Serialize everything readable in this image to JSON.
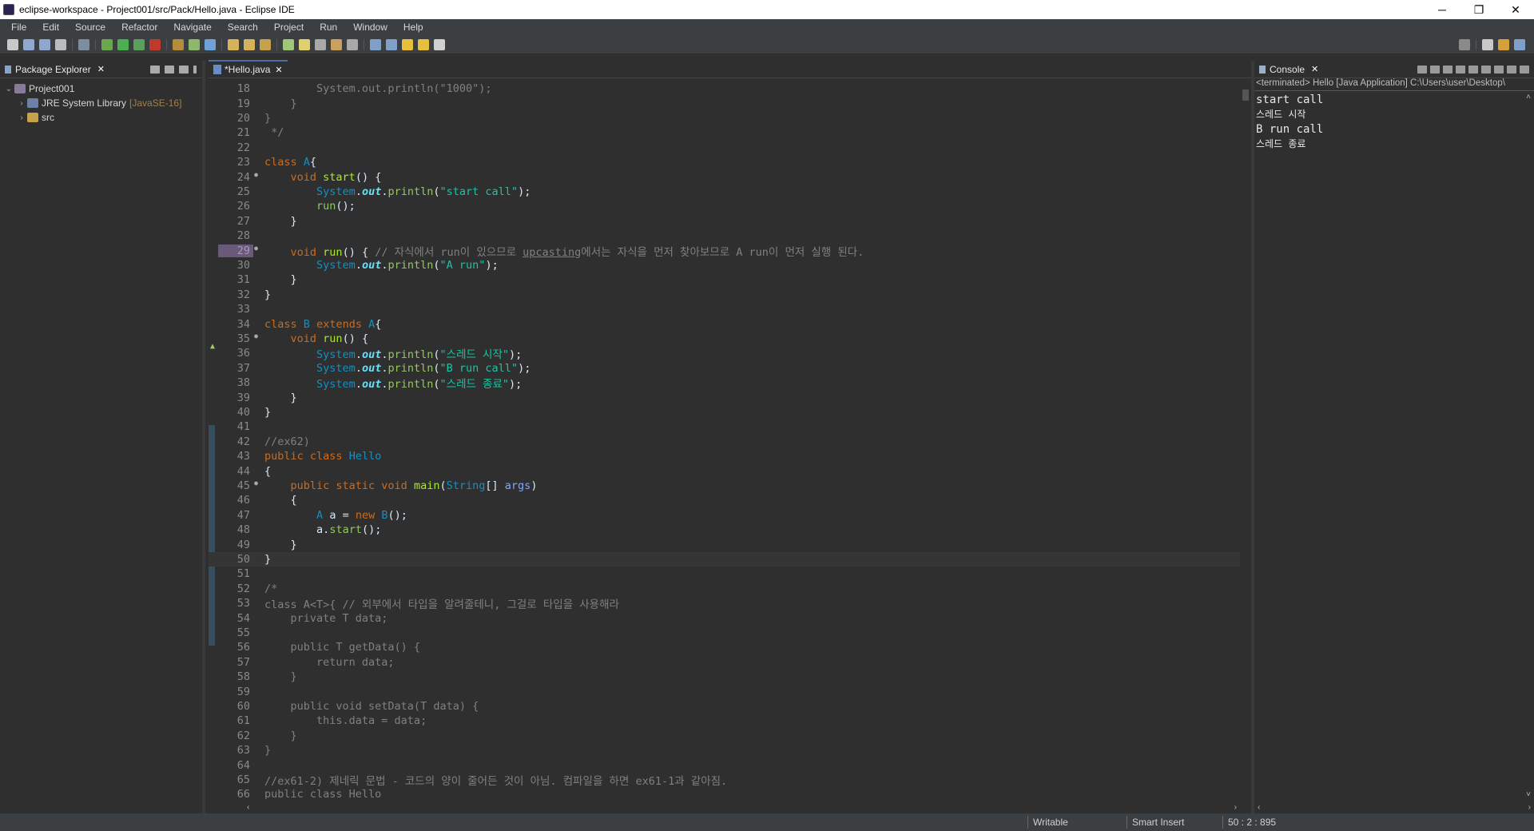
{
  "window": {
    "title": "eclipse-workspace - Project001/src/Pack/Hello.java - Eclipse IDE",
    "minimize": "─",
    "restore": "❐",
    "close": "✕"
  },
  "menu": [
    "File",
    "Edit",
    "Source",
    "Refactor",
    "Navigate",
    "Search",
    "Project",
    "Run",
    "Window",
    "Help"
  ],
  "package_explorer": {
    "tab_label": "Package Explorer",
    "tree": [
      {
        "label": "Project001",
        "arrow": "⌄",
        "decor": ""
      },
      {
        "label": "JRE System Library",
        "arrow": "›",
        "decor": "[JavaSE-16]"
      },
      {
        "label": "src",
        "arrow": "›",
        "decor": ""
      }
    ]
  },
  "editor": {
    "tab_label": "*Hello.java",
    "current_line": 50,
    "marked_line": 29
  },
  "console": {
    "tab_label": "Console",
    "status": "<terminated> Hello [Java Application] C:\\Users\\user\\Desktop\\",
    "output": [
      "start call",
      "스레드 시작",
      "B run call",
      "스레드 종료"
    ]
  },
  "statusbar": {
    "writable": "Writable",
    "insert_mode": "Smart Insert",
    "position": "50 : 2 : 895"
  },
  "colors": {
    "keyword": "#cc6c1d",
    "type": "#1290c3",
    "string": "#17c6a3",
    "comment": "#808080",
    "method": "#a7ec21",
    "background": "#2f2f2f"
  }
}
